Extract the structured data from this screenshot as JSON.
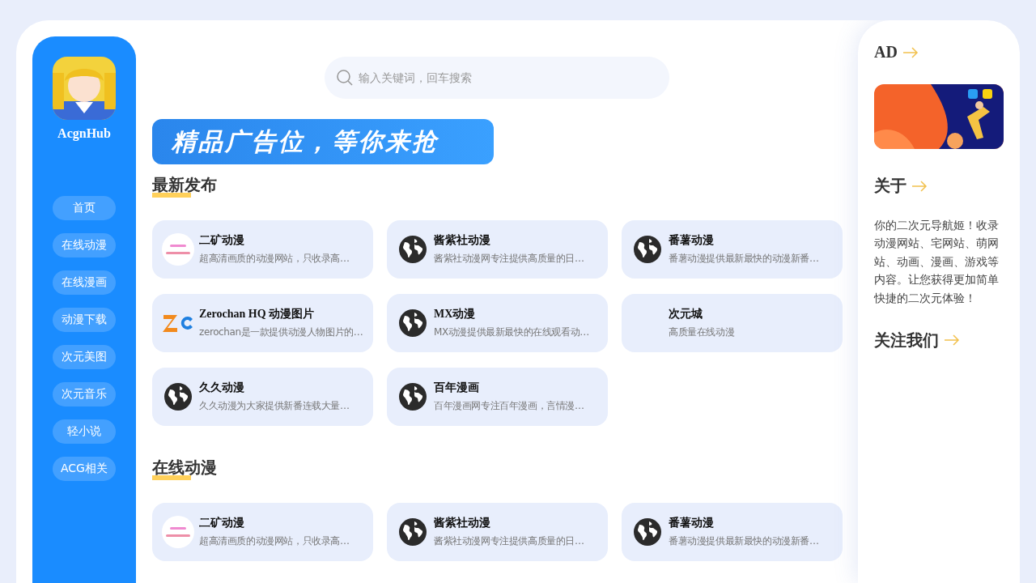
{
  "brand": {
    "name": "AcgnHub"
  },
  "nav": [
    {
      "label": "首页"
    },
    {
      "label": "在线动漫"
    },
    {
      "label": "在线漫画"
    },
    {
      "label": "动漫下载"
    },
    {
      "label": "次元美图"
    },
    {
      "label": "次元音乐"
    },
    {
      "label": "轻小说"
    },
    {
      "label": "ACG相关"
    }
  ],
  "search": {
    "placeholder": "输入关键词，回车搜索"
  },
  "banner": {
    "text": "精品广告位，等你来抢"
  },
  "sections": [
    {
      "title": "最新发布",
      "sites": [
        {
          "kind": "lines",
          "name": "二矿动漫",
          "desc": "超高清画质的动漫网站，只收录高…"
        },
        {
          "kind": "globe",
          "name": "酱紫社动漫",
          "desc": "酱紫社动漫网专注提供高质量的日…"
        },
        {
          "kind": "globe",
          "name": "番薯动漫",
          "desc": "番薯动漫提供最新最快的动漫新番…"
        },
        {
          "kind": "zc",
          "name": "Zerochan HQ 动漫图片",
          "desc": "zerochan是一款提供动漫人物图片的…"
        },
        {
          "kind": "globe",
          "name": "MX动漫",
          "desc": "MX动漫提供最新最快的在线观看动…"
        },
        {
          "kind": "plain",
          "name": "次元城",
          "desc": "高质量在线动漫"
        },
        {
          "kind": "globe",
          "name": "久久动漫",
          "desc": "久久动漫为大家提供新番连载大量…"
        },
        {
          "kind": "globe",
          "name": "百年漫画",
          "desc": "百年漫画网专注百年漫画，言情漫…"
        }
      ]
    },
    {
      "title": "在线动漫",
      "sites": [
        {
          "kind": "lines",
          "name": "二矿动漫",
          "desc": "超高清画质的动漫网站，只收录高…"
        },
        {
          "kind": "globe",
          "name": "酱紫社动漫",
          "desc": "酱紫社动漫网专注提供高质量的日…"
        },
        {
          "kind": "globe",
          "name": "番薯动漫",
          "desc": "番薯动漫提供最新最快的动漫新番…"
        }
      ]
    }
  ],
  "aside": [
    {
      "kind": "ad",
      "title": "AD"
    },
    {
      "kind": "text",
      "title": "关于",
      "text": "你的二次元导航姬！收录动漫网站、宅网站、萌网站、动画、漫画、游戏等内容。让您获得更加简单快捷的二次元体验！"
    },
    {
      "kind": "heading",
      "title": "关注我们"
    }
  ]
}
